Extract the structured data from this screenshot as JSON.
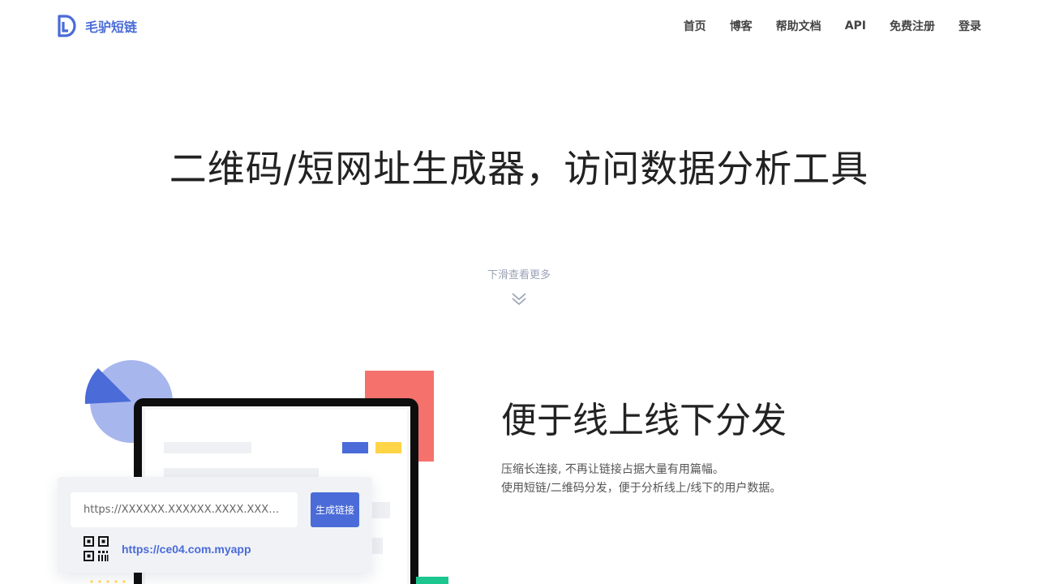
{
  "brand": {
    "name": "毛驴短链",
    "logo_icon": "d-logo-icon",
    "color": "#4a6bd8"
  },
  "nav": {
    "items": [
      "首页",
      "博客",
      "帮助文档",
      "API",
      "免费注册",
      "登录"
    ]
  },
  "hero": {
    "title": "二维码/短网址生成器，访问数据分析工具"
  },
  "scroll_hint": {
    "text": "下滑查看更多",
    "icon": "double-chevron-down-icon"
  },
  "demo": {
    "input_value": "https://XXXXXX.XXXXXX.XXXX.XXXX...",
    "button_label": "生成链接",
    "qr_icon": "qr-code-icon",
    "short_link": "https://ce04.com.myapp"
  },
  "feature": {
    "title": "便于线上线下分发",
    "desc_lines": [
      "压缩长连接, 不再让链接占据大量有用篇幅。",
      "使用短链/二维码分发，便于分析线上/线下的用户数据。"
    ]
  },
  "colors": {
    "accent": "#4a6bd8",
    "red": "#f5716c",
    "yellow": "#ffd447",
    "green": "#1ec68f",
    "pie_light": "#a8b6ee"
  }
}
